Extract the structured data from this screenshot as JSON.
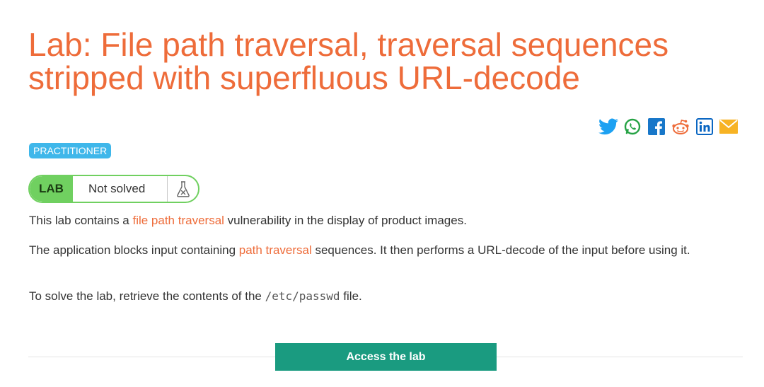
{
  "title": "Lab: File path traversal, traversal sequences stripped with superfluous URL-decode",
  "share_icons": [
    "twitter-icon",
    "whatsapp-icon",
    "facebook-icon",
    "reddit-icon",
    "linkedin-icon",
    "email-icon"
  ],
  "level_badge": "PRACTITIONER",
  "status": {
    "tag": "LAB",
    "state": "Not solved",
    "icon": "flask-icon"
  },
  "description": {
    "p1_before": "This lab contains a ",
    "p1_link": "file path traversal",
    "p1_after": " vulnerability in the display of product images.",
    "p2_before": "The application blocks input containing ",
    "p2_link": "path traversal",
    "p2_after": " sequences. It then performs a URL-decode of the input before using it.",
    "p3_before": "To solve the lab, retrieve the contents of the ",
    "p3_code": "/etc/passwd",
    "p3_after": " file."
  },
  "access_button": "Access the lab",
  "colors": {
    "title": "#ee6c3a",
    "link": "#ee6c3a",
    "badge": "#3fb7ea",
    "status_green": "#70d060",
    "button": "#1a9b80"
  }
}
